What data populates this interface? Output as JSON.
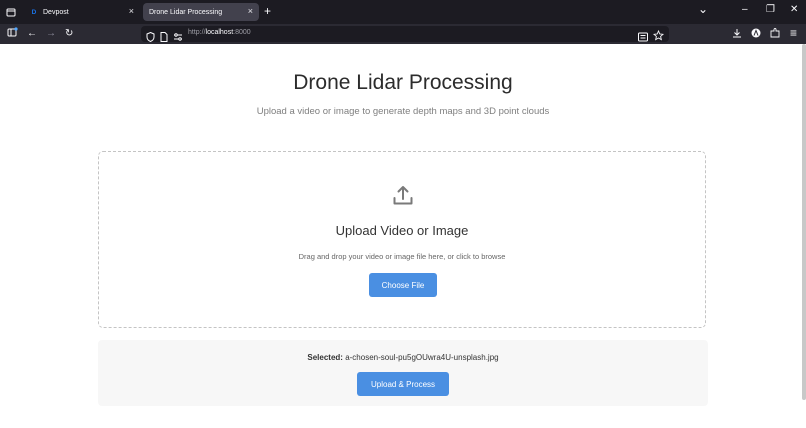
{
  "browser": {
    "tabs": [
      {
        "label": "Devpost",
        "favicon": "D",
        "active": false
      },
      {
        "label": "Drone Lidar Processing",
        "active": true
      }
    ],
    "url_prefix": "http://",
    "url_host": "localhost",
    "url_suffix": ":8000",
    "icons": {
      "tab_list": "tab-list-icon",
      "close": "×",
      "new_tab": "+",
      "chevron": "⌄",
      "minimize": "–",
      "restore": "❐",
      "window_close": "✕",
      "back": "←",
      "forward": "→",
      "reload": "↻",
      "menu": "≡"
    }
  },
  "page": {
    "title": "Drone Lidar Processing",
    "subtitle": "Upload a video or image to generate depth maps and 3D point clouds",
    "dropzone": {
      "title": "Upload Video or Image",
      "hint": "Drag and drop your video or image file here, or click to browse",
      "choose_label": "Choose File"
    },
    "selection": {
      "label": "Selected:",
      "filename": "a-chosen-soul-pu5gOUwra4U-unsplash.jpg",
      "process_label": "Upload & Process"
    }
  },
  "colors": {
    "accent": "#4a8fe2",
    "chrome_dark": "#1c1b22",
    "toolbar": "#2b2a33"
  }
}
